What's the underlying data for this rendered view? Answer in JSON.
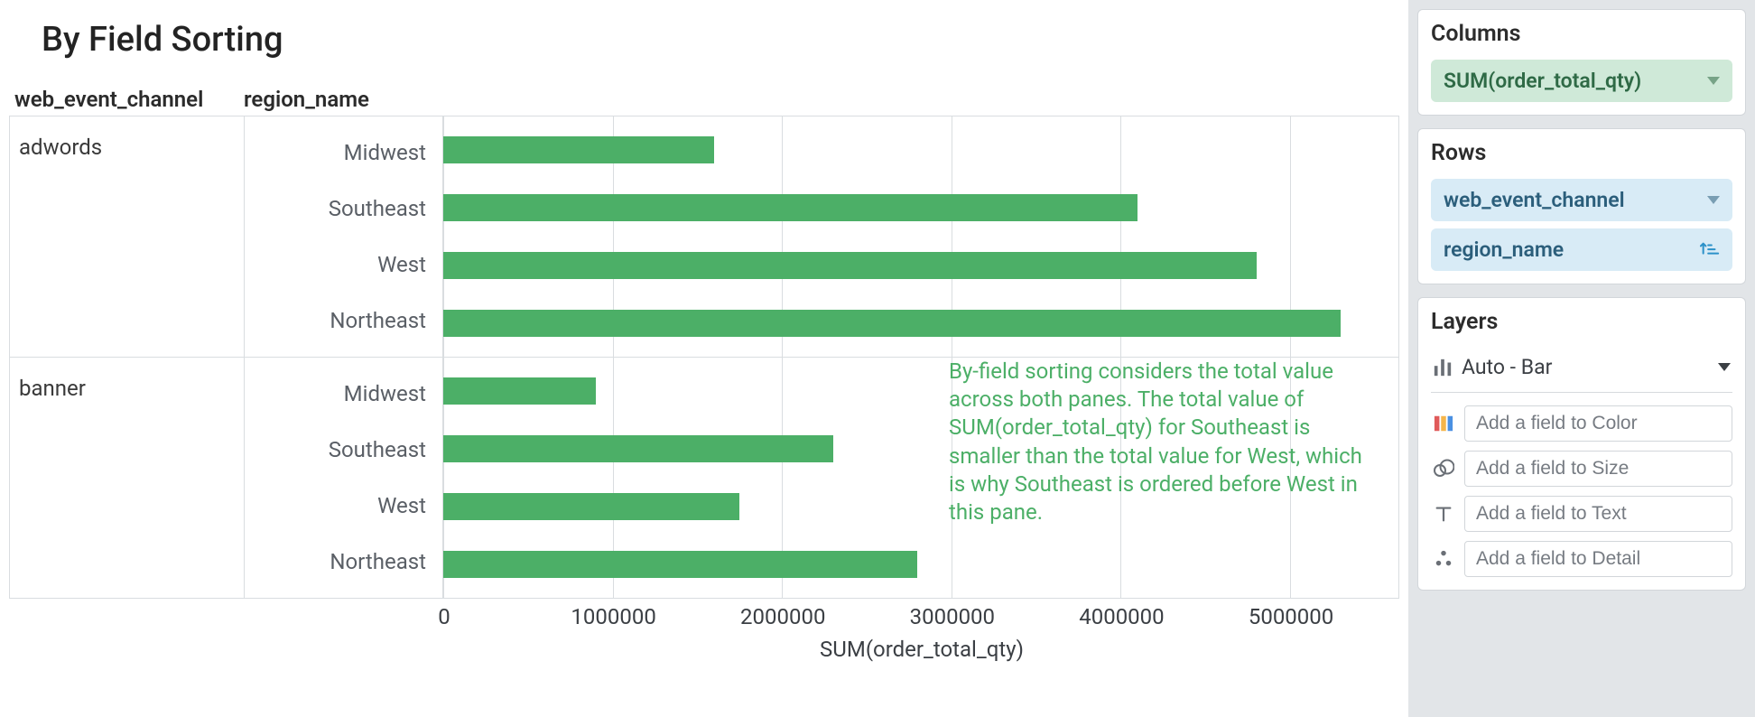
{
  "title": "By Field Sorting",
  "headers": {
    "channel": "web_event_channel",
    "region": "region_name"
  },
  "chart_data": {
    "type": "bar",
    "orientation": "horizontal",
    "xlabel": "SUM(order_total_qty)",
    "ylabel": "",
    "xlim": [
      0,
      5650000
    ],
    "ticks": [
      0,
      1000000,
      2000000,
      3000000,
      4000000,
      5000000
    ],
    "tick_labels": [
      "0",
      "1000000",
      "2000000",
      "3000000",
      "4000000",
      "5000000"
    ],
    "panes": [
      {
        "channel": "adwords",
        "rows": [
          {
            "region": "Midwest",
            "value": 1600000
          },
          {
            "region": "Southeast",
            "value": 4100000
          },
          {
            "region": "West",
            "value": 4800000
          },
          {
            "region": "Northeast",
            "value": 5300000
          }
        ]
      },
      {
        "channel": "banner",
        "rows": [
          {
            "region": "Midwest",
            "value": 900000
          },
          {
            "region": "Southeast",
            "value": 2300000
          },
          {
            "region": "West",
            "value": 1750000
          },
          {
            "region": "Northeast",
            "value": 2800000
          }
        ]
      }
    ],
    "bar_color": "#4caf67",
    "annotation": "By-field sorting considers the total value across both panes. The total value of SUM(order_total_qty) for Southeast is smaller than the total value for West, which is why Southeast is ordered before West in this pane."
  },
  "side": {
    "columns": {
      "title": "Columns",
      "pills": [
        "SUM(order_total_qty)"
      ]
    },
    "rows": {
      "title": "Rows",
      "pills": [
        "web_event_channel",
        "region_name"
      ]
    },
    "layers": {
      "title": "Layers",
      "mode": "Auto - Bar",
      "fields": {
        "color": {
          "placeholder": "Add a field to Color"
        },
        "size": {
          "placeholder": "Add a field to Size"
        },
        "text": {
          "placeholder": "Add a field to Text"
        },
        "detail": {
          "placeholder": "Add a field to Detail"
        }
      }
    }
  }
}
